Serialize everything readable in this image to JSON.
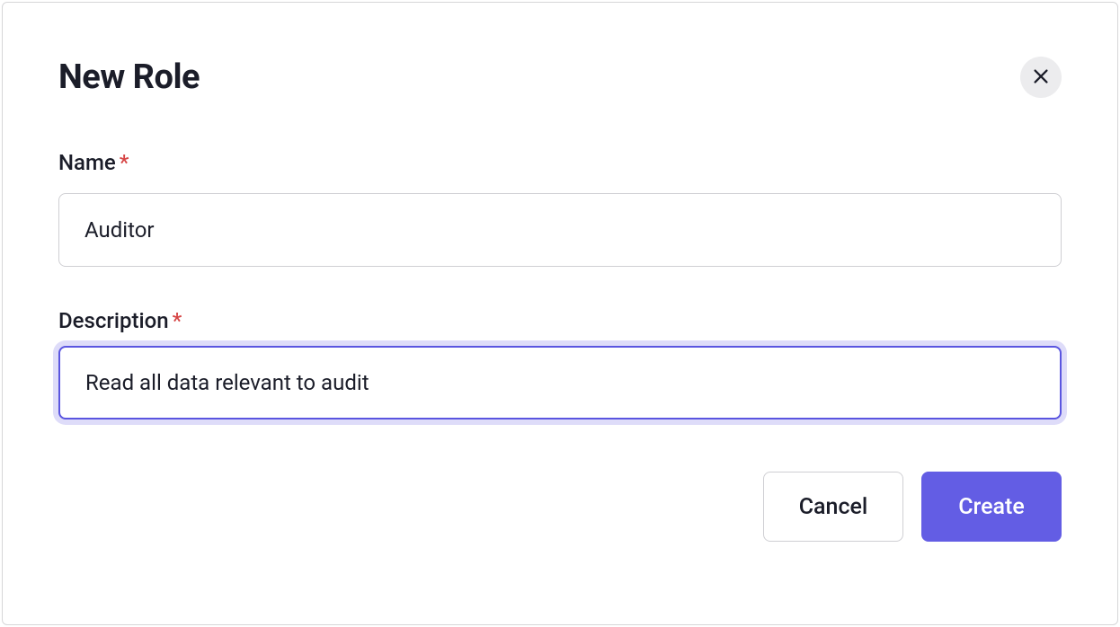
{
  "modal": {
    "title": "New Role",
    "name": {
      "label": "Name",
      "value": "Auditor"
    },
    "description": {
      "label": "Description",
      "value": "Read all data relevant to audit"
    },
    "buttons": {
      "cancel": "Cancel",
      "create": "Create"
    }
  }
}
